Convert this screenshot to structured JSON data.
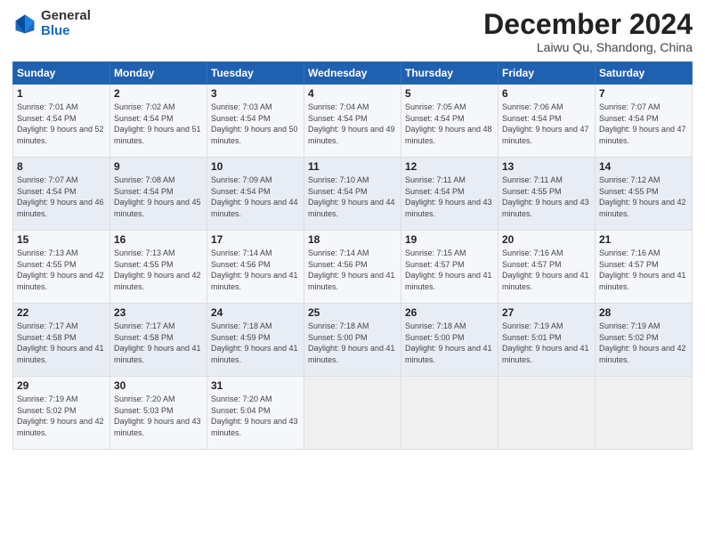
{
  "logo": {
    "general": "General",
    "blue": "Blue"
  },
  "title": "December 2024",
  "location": "Laiwu Qu, Shandong, China",
  "headers": [
    "Sunday",
    "Monday",
    "Tuesday",
    "Wednesday",
    "Thursday",
    "Friday",
    "Saturday"
  ],
  "weeks": [
    [
      {
        "day": "1",
        "sunrise": "7:01 AM",
        "sunset": "4:54 PM",
        "daylight": "9 hours and 52 minutes."
      },
      {
        "day": "2",
        "sunrise": "7:02 AM",
        "sunset": "4:54 PM",
        "daylight": "9 hours and 51 minutes."
      },
      {
        "day": "3",
        "sunrise": "7:03 AM",
        "sunset": "4:54 PM",
        "daylight": "9 hours and 50 minutes."
      },
      {
        "day": "4",
        "sunrise": "7:04 AM",
        "sunset": "4:54 PM",
        "daylight": "9 hours and 49 minutes."
      },
      {
        "day": "5",
        "sunrise": "7:05 AM",
        "sunset": "4:54 PM",
        "daylight": "9 hours and 48 minutes."
      },
      {
        "day": "6",
        "sunrise": "7:06 AM",
        "sunset": "4:54 PM",
        "daylight": "9 hours and 47 minutes."
      },
      {
        "day": "7",
        "sunrise": "7:07 AM",
        "sunset": "4:54 PM",
        "daylight": "9 hours and 47 minutes."
      }
    ],
    [
      {
        "day": "8",
        "sunrise": "7:07 AM",
        "sunset": "4:54 PM",
        "daylight": "9 hours and 46 minutes."
      },
      {
        "day": "9",
        "sunrise": "7:08 AM",
        "sunset": "4:54 PM",
        "daylight": "9 hours and 45 minutes."
      },
      {
        "day": "10",
        "sunrise": "7:09 AM",
        "sunset": "4:54 PM",
        "daylight": "9 hours and 44 minutes."
      },
      {
        "day": "11",
        "sunrise": "7:10 AM",
        "sunset": "4:54 PM",
        "daylight": "9 hours and 44 minutes."
      },
      {
        "day": "12",
        "sunrise": "7:11 AM",
        "sunset": "4:54 PM",
        "daylight": "9 hours and 43 minutes."
      },
      {
        "day": "13",
        "sunrise": "7:11 AM",
        "sunset": "4:55 PM",
        "daylight": "9 hours and 43 minutes."
      },
      {
        "day": "14",
        "sunrise": "7:12 AM",
        "sunset": "4:55 PM",
        "daylight": "9 hours and 42 minutes."
      }
    ],
    [
      {
        "day": "15",
        "sunrise": "7:13 AM",
        "sunset": "4:55 PM",
        "daylight": "9 hours and 42 minutes."
      },
      {
        "day": "16",
        "sunrise": "7:13 AM",
        "sunset": "4:55 PM",
        "daylight": "9 hours and 42 minutes."
      },
      {
        "day": "17",
        "sunrise": "7:14 AM",
        "sunset": "4:56 PM",
        "daylight": "9 hours and 41 minutes."
      },
      {
        "day": "18",
        "sunrise": "7:14 AM",
        "sunset": "4:56 PM",
        "daylight": "9 hours and 41 minutes."
      },
      {
        "day": "19",
        "sunrise": "7:15 AM",
        "sunset": "4:57 PM",
        "daylight": "9 hours and 41 minutes."
      },
      {
        "day": "20",
        "sunrise": "7:16 AM",
        "sunset": "4:57 PM",
        "daylight": "9 hours and 41 minutes."
      },
      {
        "day": "21",
        "sunrise": "7:16 AM",
        "sunset": "4:57 PM",
        "daylight": "9 hours and 41 minutes."
      }
    ],
    [
      {
        "day": "22",
        "sunrise": "7:17 AM",
        "sunset": "4:58 PM",
        "daylight": "9 hours and 41 minutes."
      },
      {
        "day": "23",
        "sunrise": "7:17 AM",
        "sunset": "4:58 PM",
        "daylight": "9 hours and 41 minutes."
      },
      {
        "day": "24",
        "sunrise": "7:18 AM",
        "sunset": "4:59 PM",
        "daylight": "9 hours and 41 minutes."
      },
      {
        "day": "25",
        "sunrise": "7:18 AM",
        "sunset": "5:00 PM",
        "daylight": "9 hours and 41 minutes."
      },
      {
        "day": "26",
        "sunrise": "7:18 AM",
        "sunset": "5:00 PM",
        "daylight": "9 hours and 41 minutes."
      },
      {
        "day": "27",
        "sunrise": "7:19 AM",
        "sunset": "5:01 PM",
        "daylight": "9 hours and 41 minutes."
      },
      {
        "day": "28",
        "sunrise": "7:19 AM",
        "sunset": "5:02 PM",
        "daylight": "9 hours and 42 minutes."
      }
    ],
    [
      {
        "day": "29",
        "sunrise": "7:19 AM",
        "sunset": "5:02 PM",
        "daylight": "9 hours and 42 minutes."
      },
      {
        "day": "30",
        "sunrise": "7:20 AM",
        "sunset": "5:03 PM",
        "daylight": "9 hours and 43 minutes."
      },
      {
        "day": "31",
        "sunrise": "7:20 AM",
        "sunset": "5:04 PM",
        "daylight": "9 hours and 43 minutes."
      },
      null,
      null,
      null,
      null
    ]
  ],
  "labels": {
    "sunrise": "Sunrise:",
    "sunset": "Sunset:",
    "daylight": "Daylight:"
  }
}
